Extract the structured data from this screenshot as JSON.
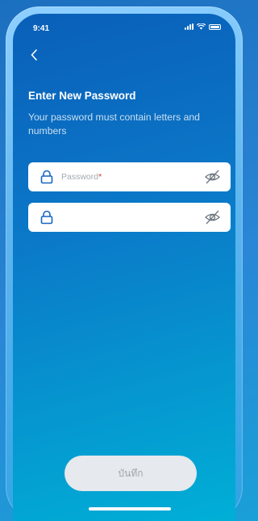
{
  "status_bar": {
    "time": "9:41"
  },
  "page": {
    "title": "Enter New Password",
    "subtitle": "Your password must contain letters and numbers"
  },
  "form": {
    "password_placeholder": "Password",
    "password_required_mark": "*",
    "password_value": "",
    "confirm_value": ""
  },
  "actions": {
    "save_label": "บันทึก"
  },
  "colors": {
    "background_top": "#0a5fb8",
    "background_bottom": "#00afd6",
    "input_icon": "#1565c0",
    "button_disabled_bg": "#e6e9ed",
    "button_disabled_text": "#9fa6ae",
    "required_mark": "#d8342e"
  },
  "icons": [
    "back-icon",
    "lock-icon",
    "eye-off-icon",
    "signal-icon",
    "wifi-icon",
    "battery-icon"
  ]
}
